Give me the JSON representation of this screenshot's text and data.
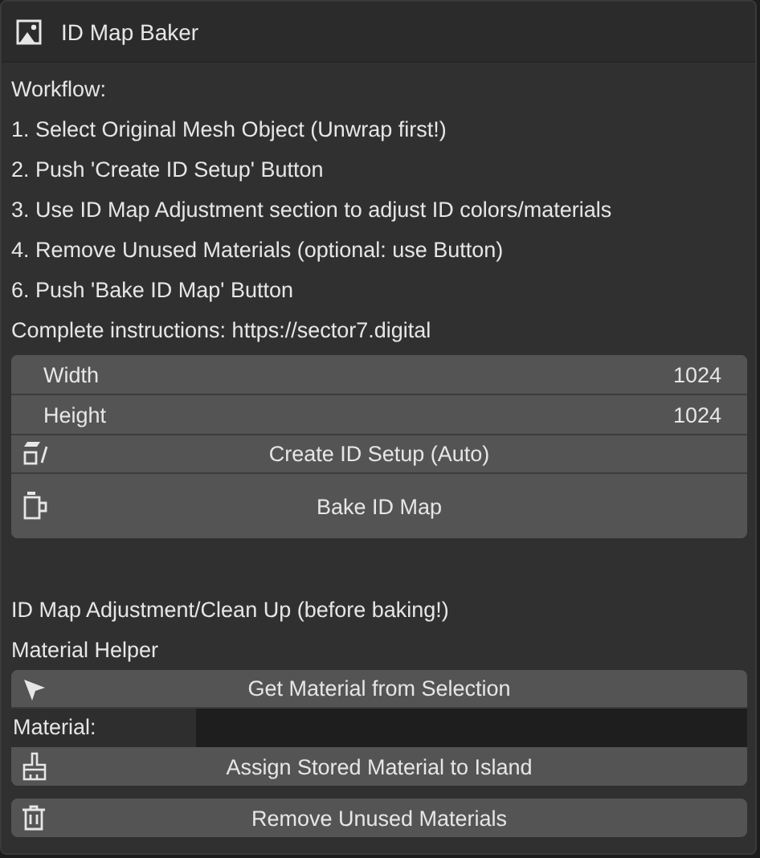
{
  "panel": {
    "title": "ID Map Baker"
  },
  "instructions": [
    "Workflow:",
    "1. Select Original Mesh Object (Unwrap first!)",
    "2. Push 'Create ID Setup' Button",
    "3. Use ID Map Adjustment section to adjust ID colors/materials",
    "4. Remove Unused Materials (optional: use Button)",
    "6. Push 'Bake ID Map' Button",
    "Complete instructions: https://sector7.digital"
  ],
  "bake_box": {
    "fields": [
      {
        "label": "Width",
        "value": "1024"
      },
      {
        "label": "Height",
        "value": "1024"
      }
    ],
    "buttons": [
      {
        "label": "Create ID Setup (Auto)",
        "kind": "setup"
      },
      {
        "label": "Bake ID Map",
        "kind": "bake"
      }
    ]
  },
  "adjustment": {
    "title": "ID Map Adjustment/Clean Up (before baking!)",
    "subtitle": "Material Helper",
    "get_button": {
      "label": "Get Material from Selection",
      "kind": "cursor"
    },
    "material_field": {
      "label": "Material:"
    },
    "assign_button": {
      "label": "Assign Stored Material to Island",
      "kind": "brush"
    },
    "remove_button": {
      "label": "Remove Unused Materials",
      "kind": "trash"
    }
  }
}
